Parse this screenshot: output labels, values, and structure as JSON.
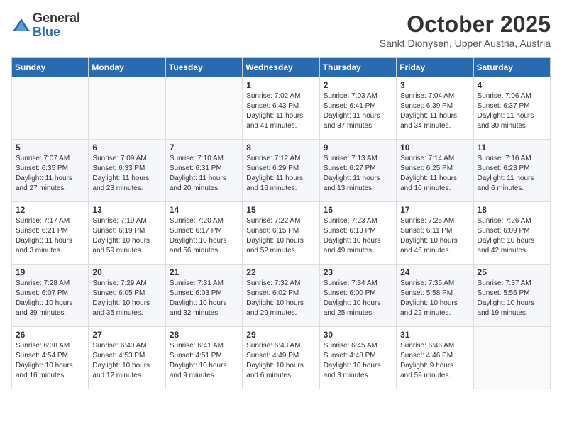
{
  "logo": {
    "general": "General",
    "blue": "Blue"
  },
  "title": "October 2025",
  "location": "Sankt Dionysen, Upper Austria, Austria",
  "weekdays": [
    "Sunday",
    "Monday",
    "Tuesday",
    "Wednesday",
    "Thursday",
    "Friday",
    "Saturday"
  ],
  "weeks": [
    [
      {
        "day": "",
        "info": ""
      },
      {
        "day": "",
        "info": ""
      },
      {
        "day": "",
        "info": ""
      },
      {
        "day": "1",
        "info": "Sunrise: 7:02 AM\nSunset: 6:43 PM\nDaylight: 11 hours\nand 41 minutes."
      },
      {
        "day": "2",
        "info": "Sunrise: 7:03 AM\nSunset: 6:41 PM\nDaylight: 11 hours\nand 37 minutes."
      },
      {
        "day": "3",
        "info": "Sunrise: 7:04 AM\nSunset: 6:39 PM\nDaylight: 11 hours\nand 34 minutes."
      },
      {
        "day": "4",
        "info": "Sunrise: 7:06 AM\nSunset: 6:37 PM\nDaylight: 11 hours\nand 30 minutes."
      }
    ],
    [
      {
        "day": "5",
        "info": "Sunrise: 7:07 AM\nSunset: 6:35 PM\nDaylight: 11 hours\nand 27 minutes."
      },
      {
        "day": "6",
        "info": "Sunrise: 7:09 AM\nSunset: 6:33 PM\nDaylight: 11 hours\nand 23 minutes."
      },
      {
        "day": "7",
        "info": "Sunrise: 7:10 AM\nSunset: 6:31 PM\nDaylight: 11 hours\nand 20 minutes."
      },
      {
        "day": "8",
        "info": "Sunrise: 7:12 AM\nSunset: 6:29 PM\nDaylight: 11 hours\nand 16 minutes."
      },
      {
        "day": "9",
        "info": "Sunrise: 7:13 AM\nSunset: 6:27 PM\nDaylight: 11 hours\nand 13 minutes."
      },
      {
        "day": "10",
        "info": "Sunrise: 7:14 AM\nSunset: 6:25 PM\nDaylight: 11 hours\nand 10 minutes."
      },
      {
        "day": "11",
        "info": "Sunrise: 7:16 AM\nSunset: 6:23 PM\nDaylight: 11 hours\nand 6 minutes."
      }
    ],
    [
      {
        "day": "12",
        "info": "Sunrise: 7:17 AM\nSunset: 6:21 PM\nDaylight: 11 hours\nand 3 minutes."
      },
      {
        "day": "13",
        "info": "Sunrise: 7:19 AM\nSunset: 6:19 PM\nDaylight: 10 hours\nand 59 minutes."
      },
      {
        "day": "14",
        "info": "Sunrise: 7:20 AM\nSunset: 6:17 PM\nDaylight: 10 hours\nand 56 minutes."
      },
      {
        "day": "15",
        "info": "Sunrise: 7:22 AM\nSunset: 6:15 PM\nDaylight: 10 hours\nand 52 minutes."
      },
      {
        "day": "16",
        "info": "Sunrise: 7:23 AM\nSunset: 6:13 PM\nDaylight: 10 hours\nand 49 minutes."
      },
      {
        "day": "17",
        "info": "Sunrise: 7:25 AM\nSunset: 6:11 PM\nDaylight: 10 hours\nand 46 minutes."
      },
      {
        "day": "18",
        "info": "Sunrise: 7:26 AM\nSunset: 6:09 PM\nDaylight: 10 hours\nand 42 minutes."
      }
    ],
    [
      {
        "day": "19",
        "info": "Sunrise: 7:28 AM\nSunset: 6:07 PM\nDaylight: 10 hours\nand 39 minutes."
      },
      {
        "day": "20",
        "info": "Sunrise: 7:29 AM\nSunset: 6:05 PM\nDaylight: 10 hours\nand 35 minutes."
      },
      {
        "day": "21",
        "info": "Sunrise: 7:31 AM\nSunset: 6:03 PM\nDaylight: 10 hours\nand 32 minutes."
      },
      {
        "day": "22",
        "info": "Sunrise: 7:32 AM\nSunset: 6:02 PM\nDaylight: 10 hours\nand 29 minutes."
      },
      {
        "day": "23",
        "info": "Sunrise: 7:34 AM\nSunset: 6:00 PM\nDaylight: 10 hours\nand 25 minutes."
      },
      {
        "day": "24",
        "info": "Sunrise: 7:35 AM\nSunset: 5:58 PM\nDaylight: 10 hours\nand 22 minutes."
      },
      {
        "day": "25",
        "info": "Sunrise: 7:37 AM\nSunset: 5:56 PM\nDaylight: 10 hours\nand 19 minutes."
      }
    ],
    [
      {
        "day": "26",
        "info": "Sunrise: 6:38 AM\nSunset: 4:54 PM\nDaylight: 10 hours\nand 16 minutes."
      },
      {
        "day": "27",
        "info": "Sunrise: 6:40 AM\nSunset: 4:53 PM\nDaylight: 10 hours\nand 12 minutes."
      },
      {
        "day": "28",
        "info": "Sunrise: 6:41 AM\nSunset: 4:51 PM\nDaylight: 10 hours\nand 9 minutes."
      },
      {
        "day": "29",
        "info": "Sunrise: 6:43 AM\nSunset: 4:49 PM\nDaylight: 10 hours\nand 6 minutes."
      },
      {
        "day": "30",
        "info": "Sunrise: 6:45 AM\nSunset: 4:48 PM\nDaylight: 10 hours\nand 3 minutes."
      },
      {
        "day": "31",
        "info": "Sunrise: 6:46 AM\nSunset: 4:46 PM\nDaylight: 9 hours\nand 59 minutes."
      },
      {
        "day": "",
        "info": ""
      }
    ]
  ]
}
